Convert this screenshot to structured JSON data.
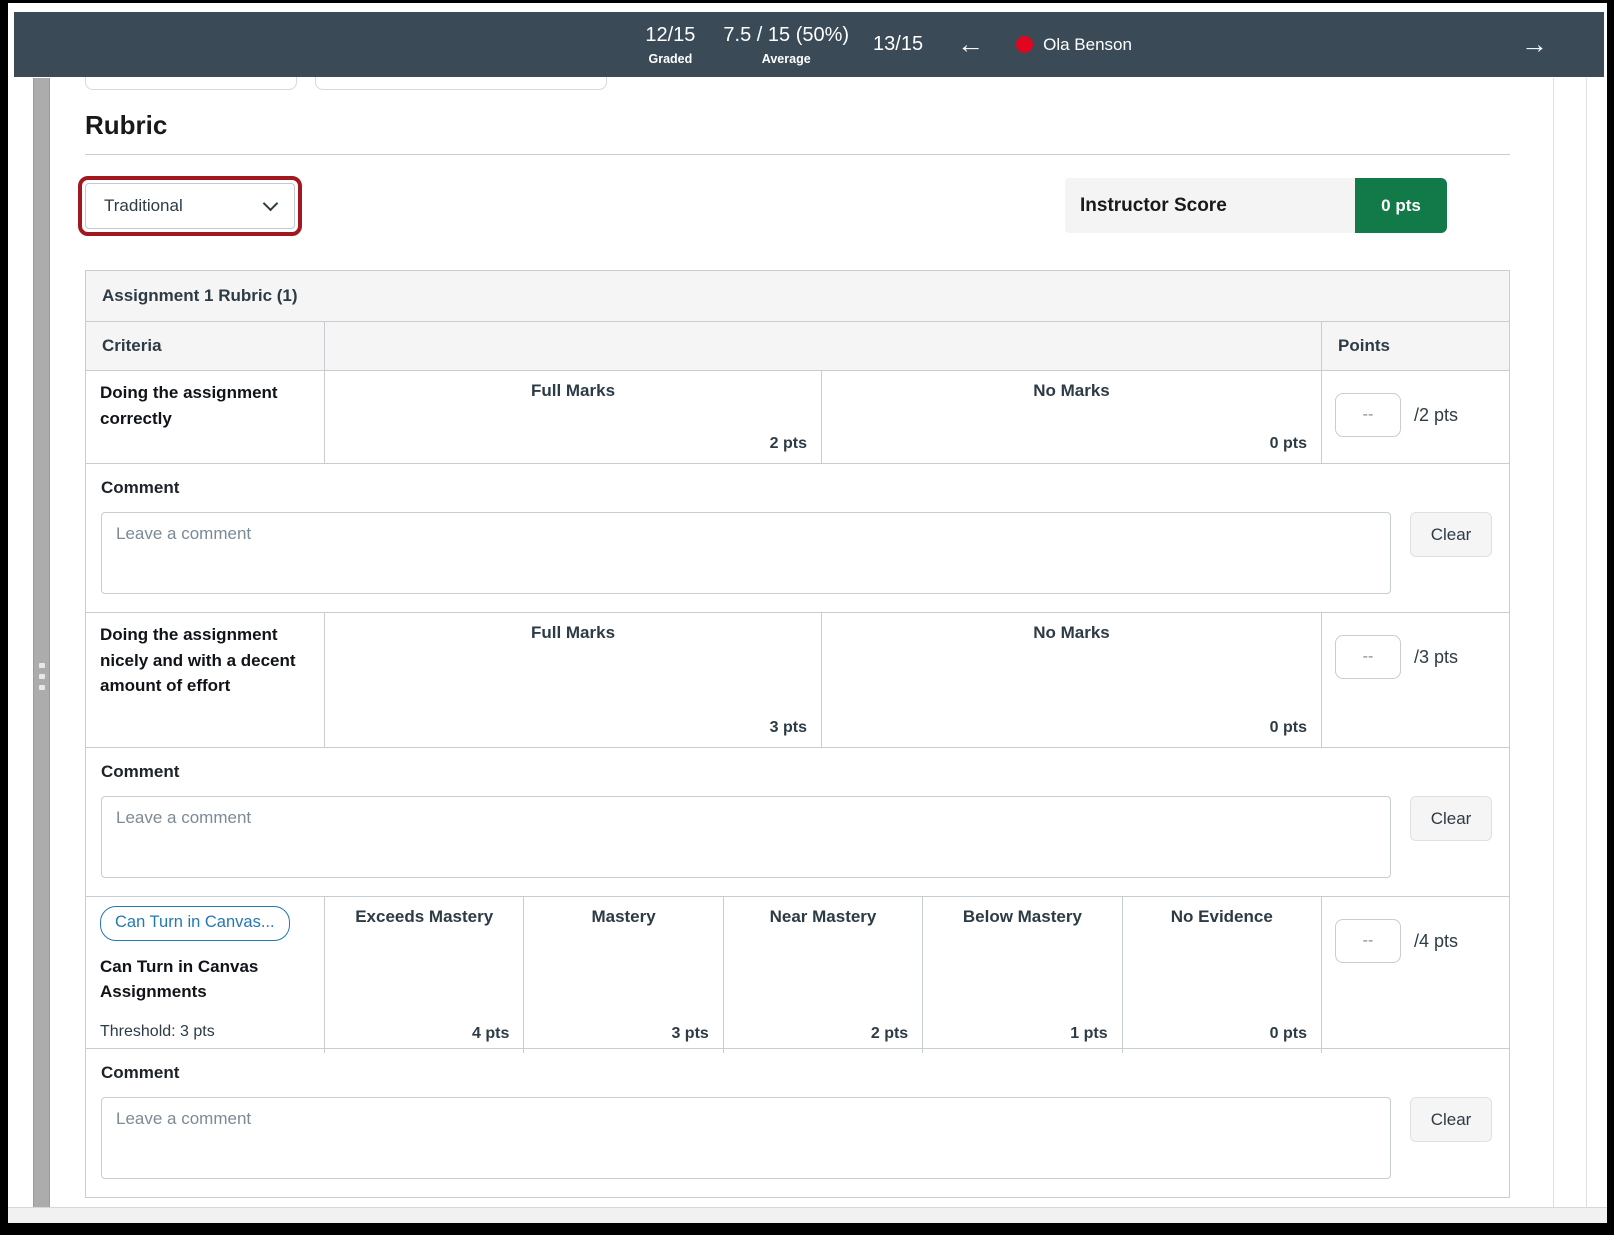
{
  "topbar": {
    "graded": {
      "value": "12/15",
      "label": "Graded"
    },
    "average": {
      "value": "7.5 / 15 (50%)",
      "label": "Average"
    },
    "position": "13/15",
    "back_arrow": "←",
    "next_arrow": "→",
    "student": {
      "name": "Ola Benson"
    }
  },
  "page": {
    "title": "Rubric",
    "view_dropdown": {
      "value": "Traditional"
    },
    "instructor_score": {
      "label": "Instructor Score",
      "value": "0 pts"
    }
  },
  "table": {
    "title": "Assignment 1 Rubric (1)",
    "headers": {
      "criteria": "Criteria",
      "points": "Points"
    },
    "comment": {
      "label": "Comment",
      "placeholder": "Leave a comment",
      "clear": "Clear"
    },
    "rows": [
      {
        "criterion": "Doing the assignment correctly",
        "score": "--",
        "out_of": "/2 pts",
        "ratings": [
          {
            "title": "Full Marks",
            "pts": "2 pts"
          },
          {
            "title": "No Marks",
            "pts": "0 pts"
          }
        ]
      },
      {
        "criterion": "Doing the assignment nicely and with a decent amount of effort",
        "score": "--",
        "out_of": "/3 pts",
        "ratings": [
          {
            "title": "Full Marks",
            "pts": "3 pts"
          },
          {
            "title": "No Marks",
            "pts": "0 pts"
          }
        ]
      },
      {
        "outcome_tag": "Can Turn in Canvas...",
        "criterion": "Can Turn in Canvas Assignments",
        "threshold": "Threshold: 3 pts",
        "score": "--",
        "out_of": "/4 pts",
        "ratings": [
          {
            "title": "Exceeds Mastery",
            "pts": "4 pts"
          },
          {
            "title": "Mastery",
            "pts": "3 pts"
          },
          {
            "title": "Near Mastery",
            "pts": "2 pts"
          },
          {
            "title": "Below Mastery",
            "pts": "1 pts"
          },
          {
            "title": "No Evidence",
            "pts": "0 pts"
          }
        ]
      }
    ]
  },
  "colors": {
    "topbar_bg": "#3A4A57",
    "score_green": "#127A48",
    "status_red": "#E0061F",
    "annotation_red": "#A2181F",
    "link_blue": "#2478B3",
    "table_border": "#C7CDD1"
  }
}
